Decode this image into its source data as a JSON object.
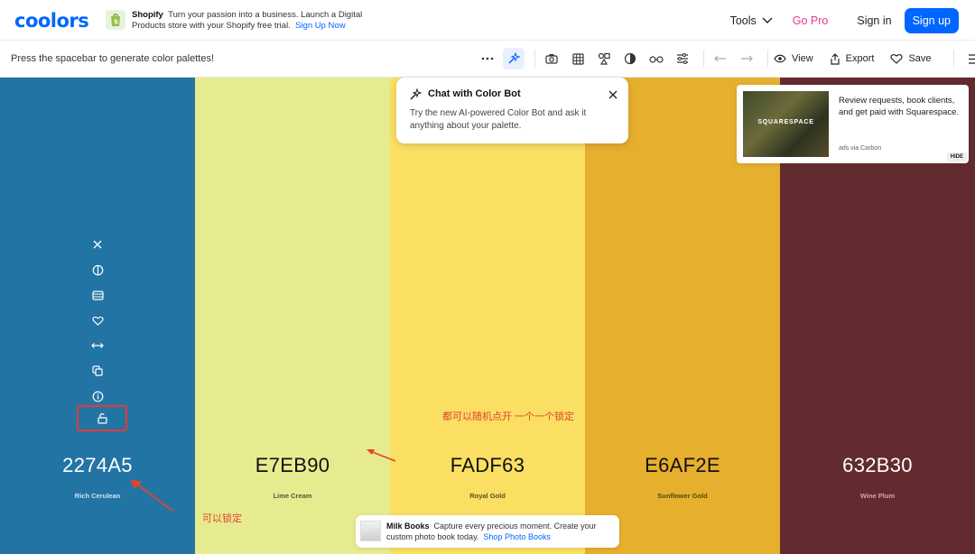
{
  "nav": {
    "logo": "coolors",
    "ad": {
      "brand": "Shopify",
      "text": "Turn your passion into a business. Launch a Digital Products store with your Shopify free trial.",
      "link": "Sign Up Now"
    },
    "tools_label": "Tools",
    "gopro_label": "Go Pro",
    "signin_label": "Sign in",
    "signup_label": "Sign up"
  },
  "toolbar": {
    "hint": "Press the spacebar to generate color palettes!",
    "view_label": "View",
    "export_label": "Export",
    "save_label": "Save"
  },
  "palette": [
    {
      "hex": "2274A5",
      "name": "Rich Cerulean",
      "color": "#2274A5",
      "text_color": "#ffffff",
      "name_color": "#cfe2ef"
    },
    {
      "hex": "E7EB90",
      "name": "Lime Cream",
      "color": "#E7EB90",
      "text_color": "#111111",
      "name_color": "#555533"
    },
    {
      "hex": "FADF63",
      "name": "Royal Gold",
      "color": "#FADF63",
      "text_color": "#111111",
      "name_color": "#5a4f22"
    },
    {
      "hex": "E6AF2E",
      "name": "Sunflower Gold",
      "color": "#E6AF2E",
      "text_color": "#111111",
      "name_color": "#5a4410"
    },
    {
      "hex": "632B30",
      "name": "Wine Plum",
      "color": "#632B30",
      "text_color": "#ffffff",
      "name_color": "#c9a9ab"
    }
  ],
  "chatbot": {
    "title": "Chat with Color Bot",
    "desc": "Try the new AI-powered Color Bot and ask it anything about your palette."
  },
  "carbon_ad": {
    "image_text": "SQUARESPACE",
    "text": "Review requests, book clients, and get paid with Squarespace.",
    "via": "ads via Carbon",
    "hide": "HIDE"
  },
  "annotations": {
    "lock_note": "可以锁定",
    "random_note": "都可以随机点开 一个一个锁定"
  },
  "bottom_ad": {
    "brand": "Milk Books",
    "text": "Capture every precious moment. Create your custom photo book today.",
    "link": "Shop Photo Books"
  },
  "colors": {
    "accent": "#0066ff",
    "gopro": "#e63c8f",
    "annotation": "#e0442f"
  }
}
